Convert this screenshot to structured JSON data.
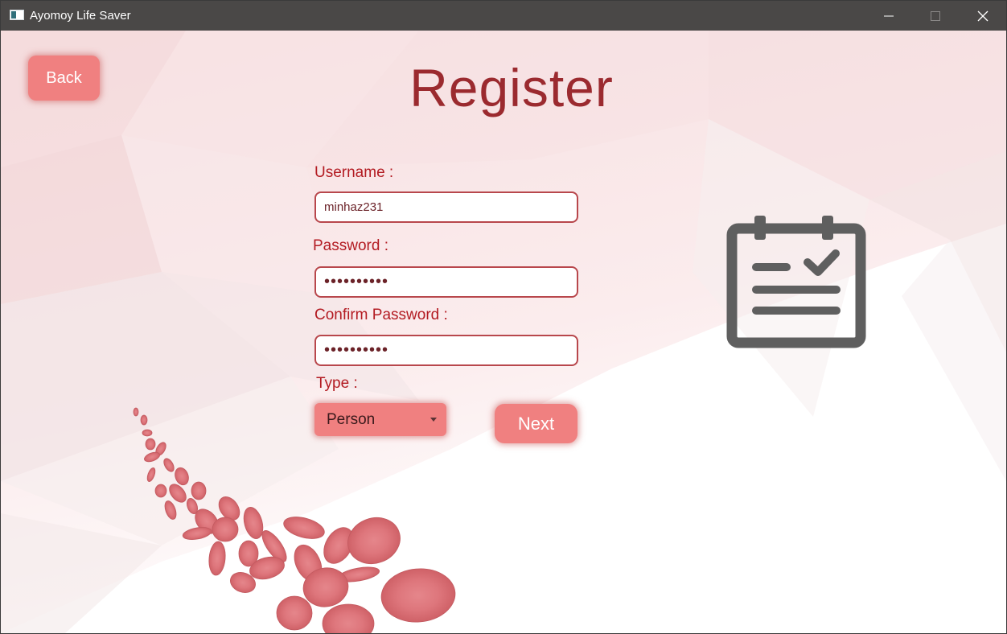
{
  "window": {
    "title": "Ayomoy Life Saver",
    "controls": [
      "minimize",
      "maximize",
      "close"
    ]
  },
  "header": {
    "back_label": "Back",
    "title": "Register"
  },
  "form": {
    "username_label": "Username :",
    "username_value": "minhaz231",
    "password_label": "Password :",
    "password_value": "••••••••••",
    "confirm_label": "Confirm Password :",
    "confirm_value": "••••••••••",
    "type_label": "Type :",
    "type_value": "Person",
    "next_label": "Next"
  },
  "icons": {
    "app": "app-window-icon",
    "illustration": "clipboard-check-icon",
    "dropdown": "chevron-down-icon"
  },
  "colors": {
    "accent": "#f08080",
    "title": "#9b2a2f",
    "label": "#b31b22",
    "titlebar": "#4a4847",
    "icon": "#5f5f5f"
  }
}
